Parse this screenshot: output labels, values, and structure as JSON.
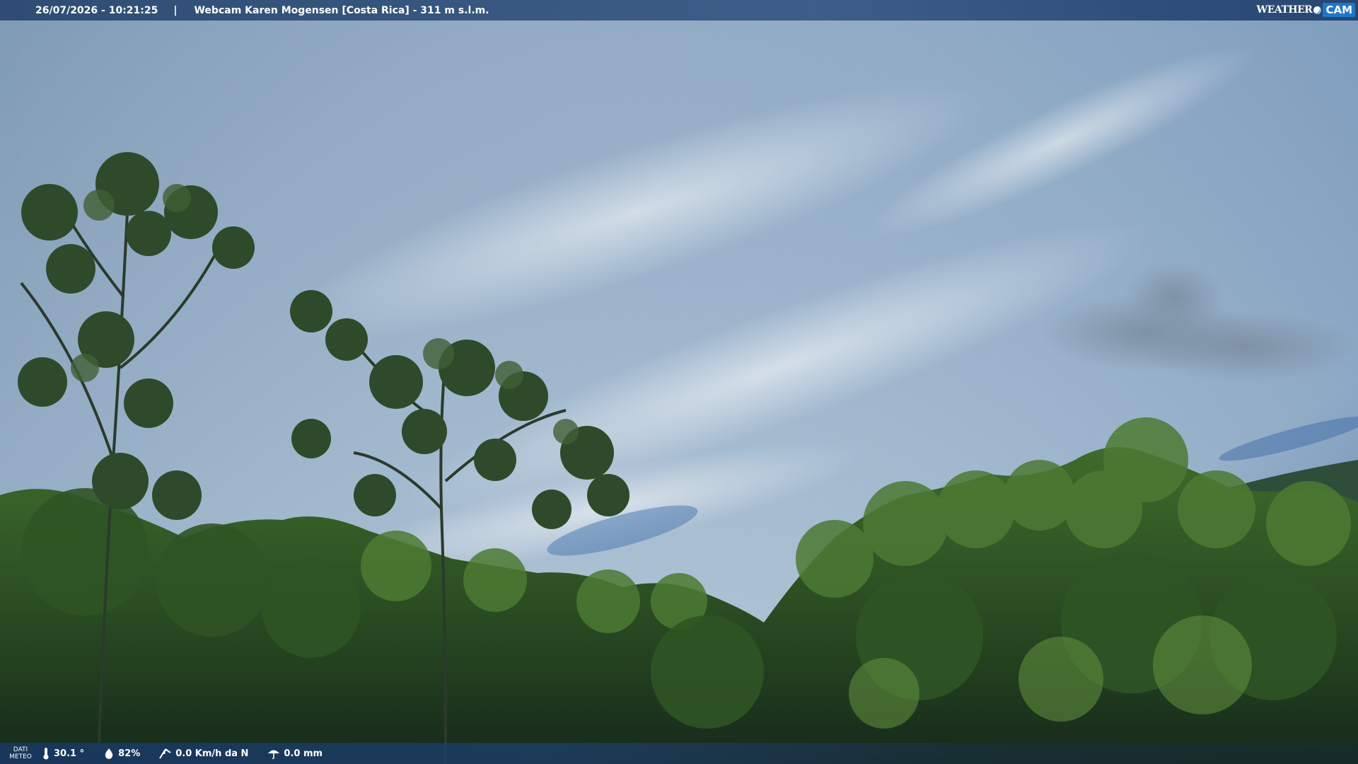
{
  "header": {
    "datetime": "26/07/2026 - 10:21:25",
    "separator": "|",
    "title": "Webcam Karen Mogensen [Costa Rica] - 311 m s.l.m.",
    "logo_weather": "WEATHER",
    "logo_cam": "CAM"
  },
  "footer": {
    "dati_line1": "DATI",
    "dati_line2": "METEO",
    "temperature": "30.1 °",
    "humidity": "82%",
    "wind": "0.0 Km/h da N",
    "rain": "0.0 mm"
  },
  "colors": {
    "sky_top": "#8aa5bf",
    "sky_mid": "#a9c0d4",
    "forest_dark": "#1e3a1a",
    "forest_light": "#4e7a34",
    "bar_blue": "#2b4a75",
    "logo_accent": "#1e78c8"
  },
  "icons": {
    "thermometer": "thermometer-icon",
    "humidity": "drop-icon",
    "wind": "wind-icon",
    "rain": "rain-icon"
  }
}
